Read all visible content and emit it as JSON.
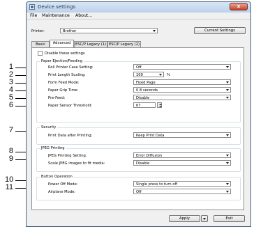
{
  "window": {
    "title": "Device settings",
    "close_glyph": "x",
    "menu": [
      "File",
      "Maintenance",
      "About..."
    ]
  },
  "printer": {
    "label": "Printer:",
    "value": "Brother",
    "current_settings_button": "Current Settings"
  },
  "tabs": [
    {
      "label": "Basic",
      "active": false
    },
    {
      "label": "Advanced",
      "active": true
    },
    {
      "label": "ESC/P Legacy (1)",
      "active": false
    },
    {
      "label": "ESC/P Legacy (2)",
      "active": false
    }
  ],
  "disable_settings": {
    "label": "Disable these settings",
    "checked": false
  },
  "groups": {
    "paper": {
      "title": "Paper Ejection/Feeding",
      "rows": [
        {
          "number": "1",
          "label": "Roll Printer Case Setting:",
          "value": "Off"
        },
        {
          "number": "2",
          "label": "Print Length Scaling:",
          "value": "100",
          "unit": "%"
        },
        {
          "number": "3",
          "label": "Form Feed Mode:",
          "value": "Fixed Page"
        },
        {
          "number": "4",
          "label": "Paper Grip Time:",
          "value": "0.8 seconds"
        },
        {
          "number": "5",
          "label": "Pre-Feed:",
          "value": "Disable"
        },
        {
          "number": "6",
          "label": "Paper Sensor Threshold:",
          "value": "67"
        }
      ]
    },
    "security": {
      "title": "Security",
      "rows": [
        {
          "number": "7",
          "label": "Print Data after Printing:",
          "value": "Keep Print Data"
        }
      ]
    },
    "jpeg": {
      "title": "JPEG Printing",
      "rows": [
        {
          "number": "8",
          "label": "JPEG Printing Setting:",
          "value": "Error Diffusion"
        },
        {
          "number": "9",
          "label": "Scale JPEG images to fit media:",
          "value": "Disable"
        }
      ]
    },
    "button": {
      "title": "Button Operation",
      "rows": [
        {
          "number": "10",
          "label": "Power Off Mode:",
          "value": "Single press to turn off"
        },
        {
          "number": "11",
          "label": "Airplane Mode:",
          "value": "Off"
        }
      ]
    }
  },
  "footer": {
    "apply": "Apply",
    "exit": "Exit"
  }
}
